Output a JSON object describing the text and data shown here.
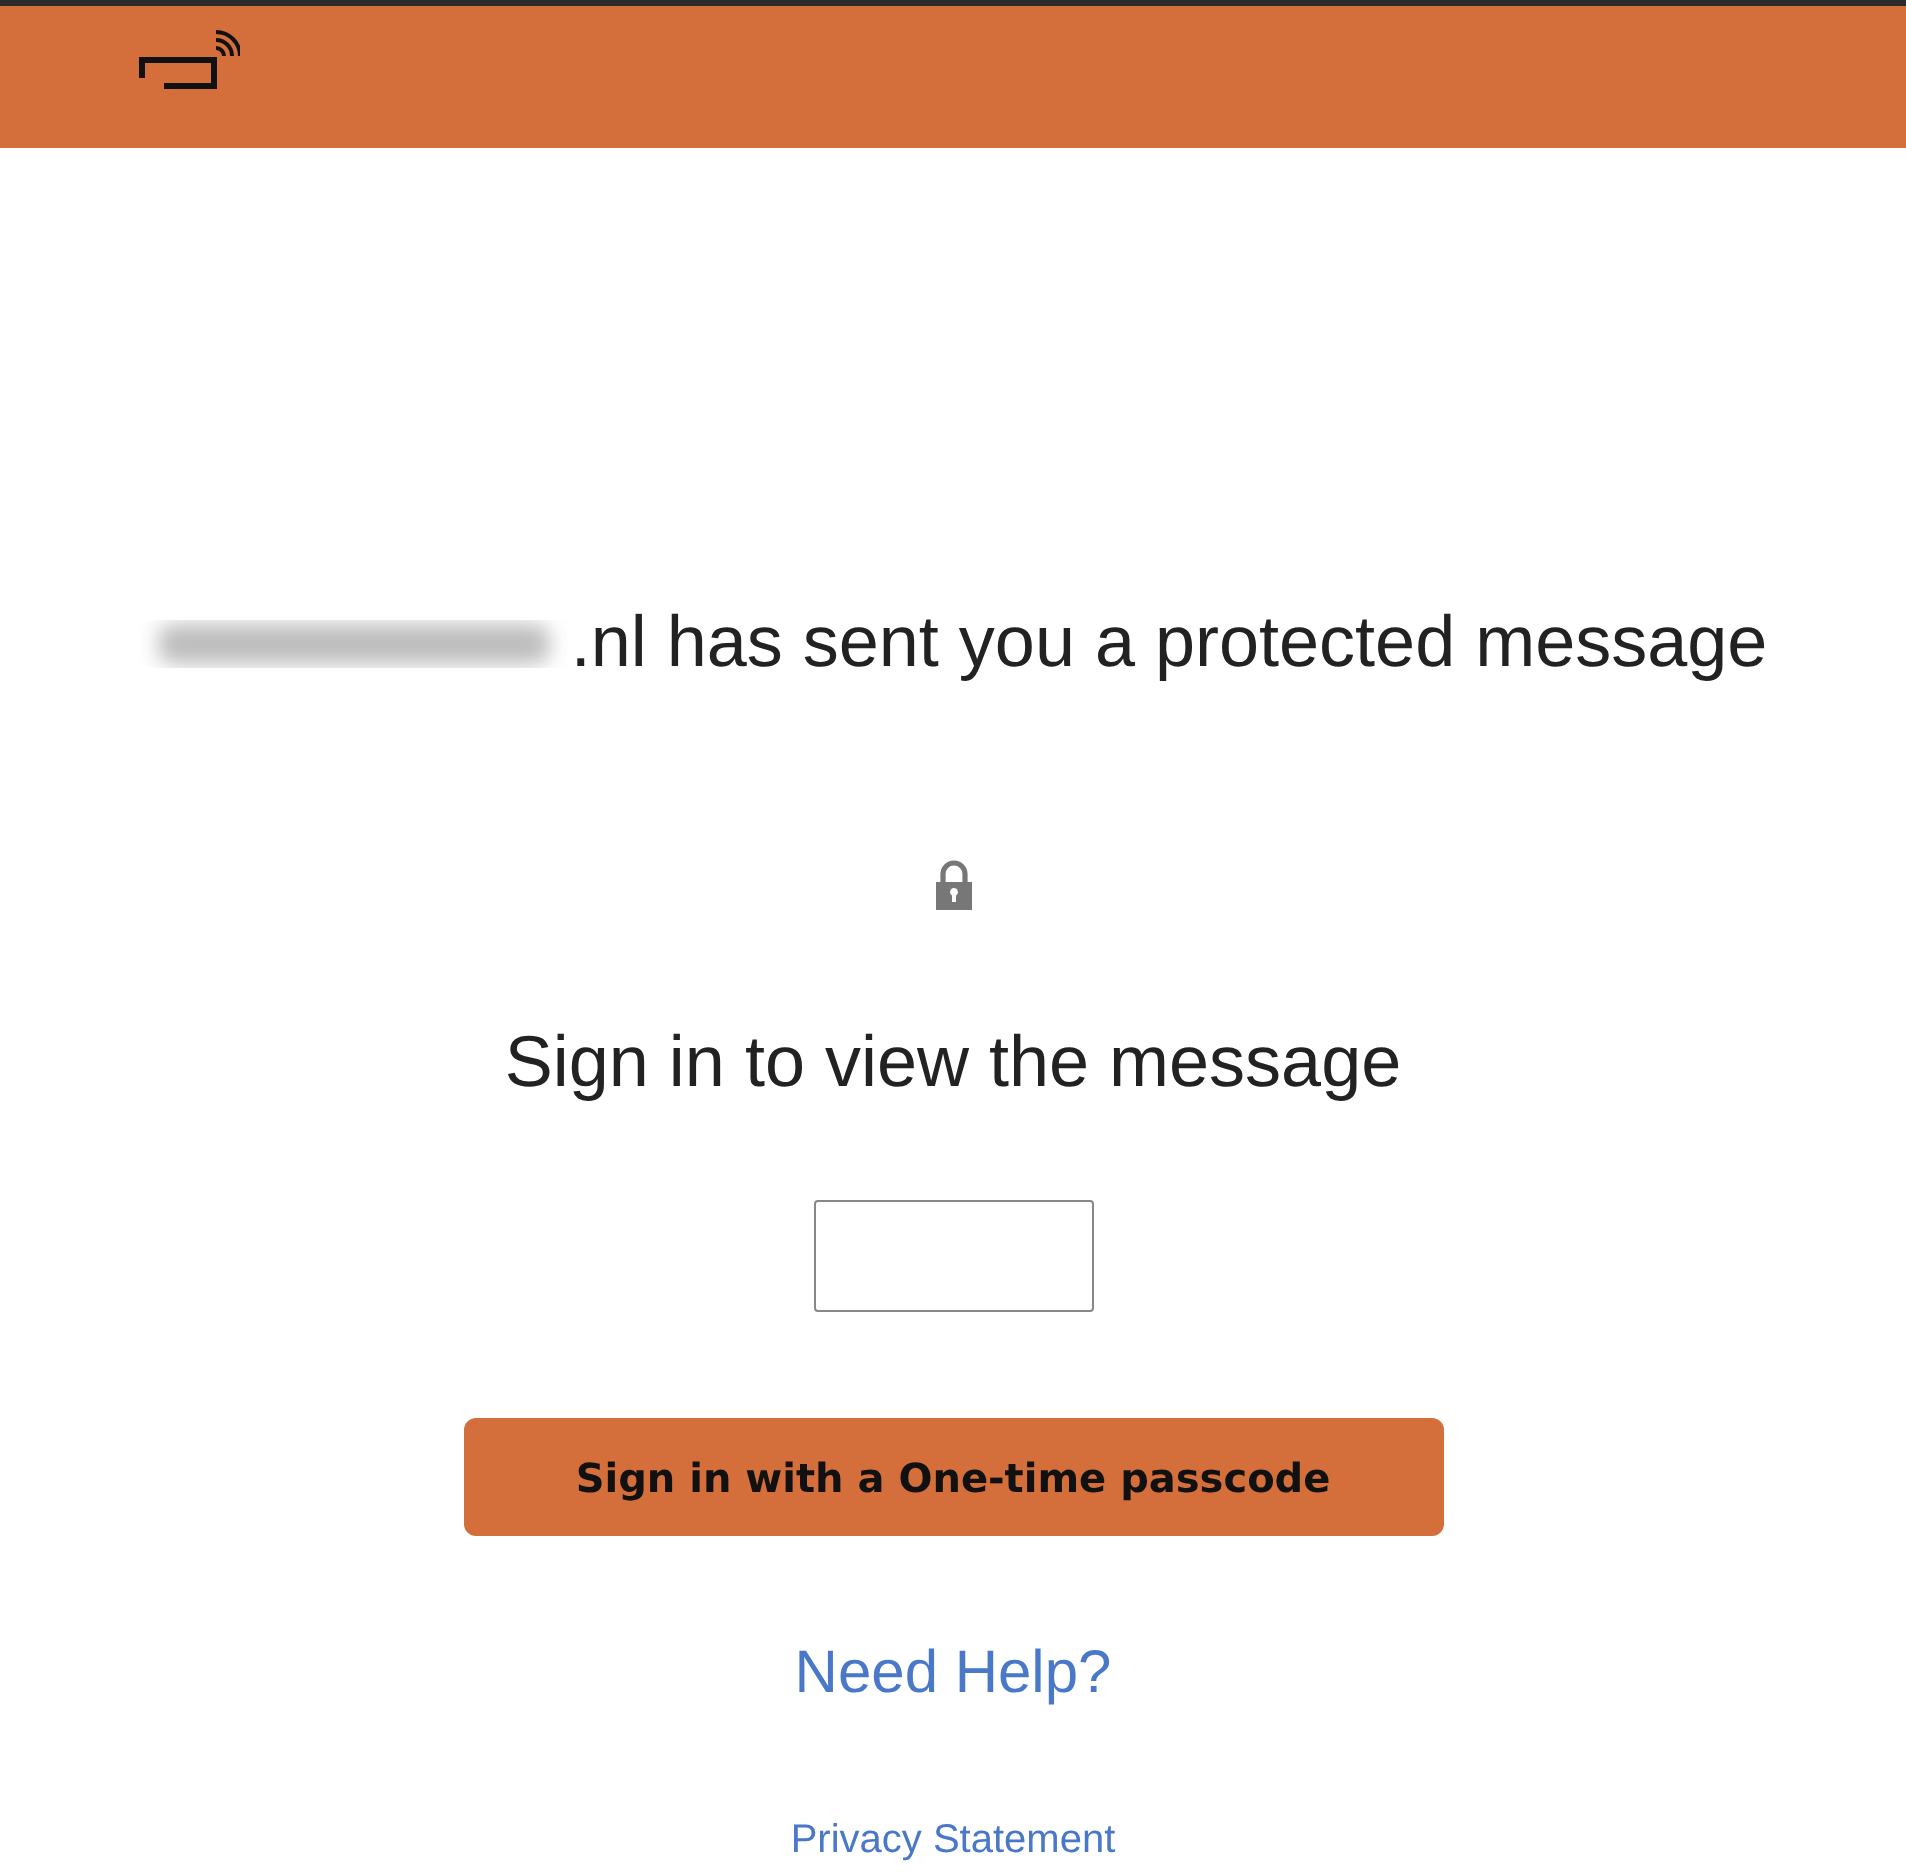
{
  "sender_line": {
    "text": ".nl has sent you a protected message"
  },
  "title": "Sign in to view the message",
  "button": "Sign in with a One-time passcode",
  "help_link": "Need Help?",
  "privacy_link": "Privacy Statement"
}
